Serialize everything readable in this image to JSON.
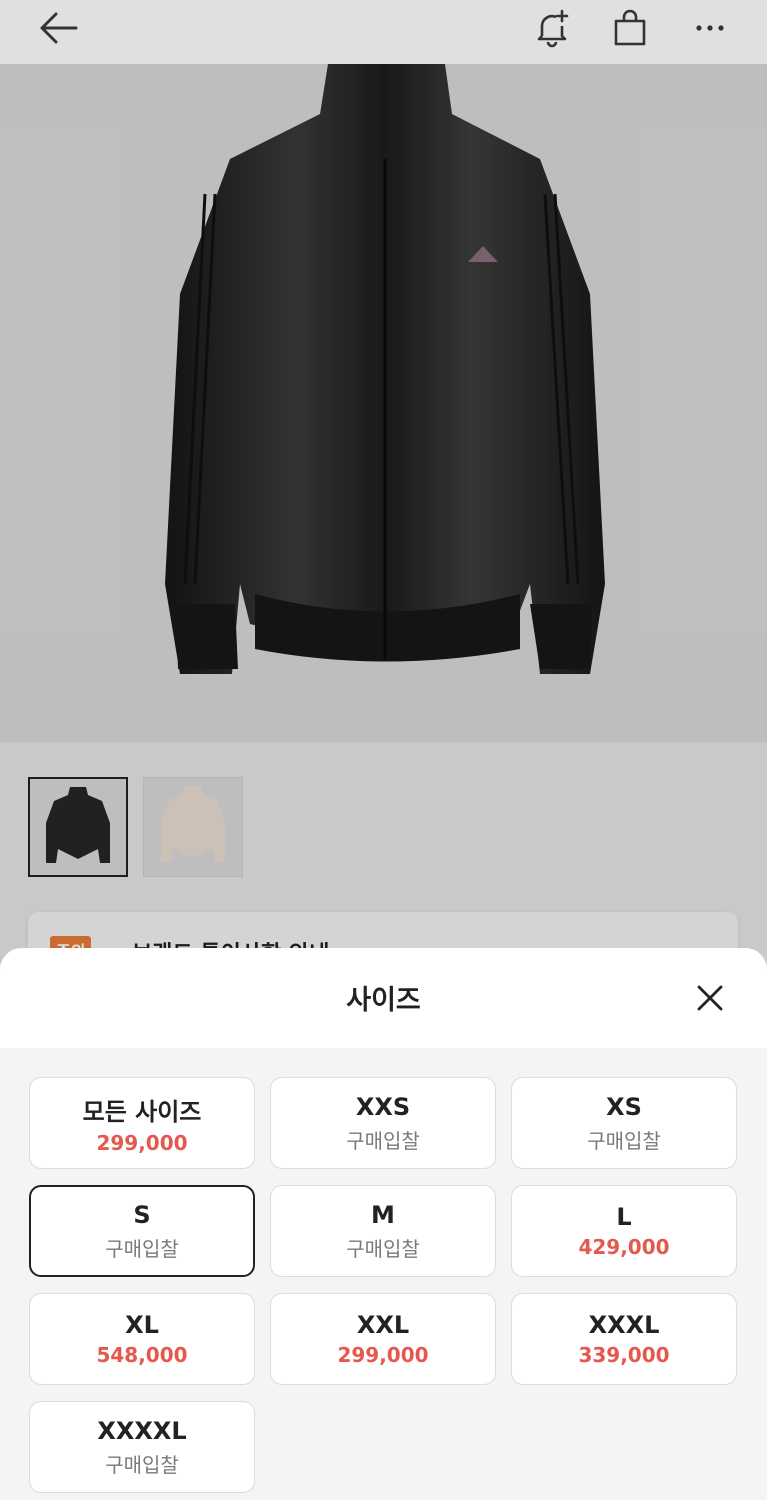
{
  "header": {
    "back_icon": "arrow-left-icon",
    "bell_icon": "bell-plus-icon",
    "bag_icon": "shopping-bag-icon",
    "more_icon": "more-horizontal-icon"
  },
  "notice": {
    "tag": "주의",
    "text": "브랜드 특이사항 안내"
  },
  "sheet": {
    "title": "사이즈",
    "close_icon": "close-icon"
  },
  "sizes": [
    {
      "label": "모든 사이즈",
      "sub": "299,000",
      "is_price": true,
      "selected": false
    },
    {
      "label": "XXS",
      "sub": "구매입찰",
      "is_price": false,
      "selected": false
    },
    {
      "label": "XS",
      "sub": "구매입찰",
      "is_price": false,
      "selected": false
    },
    {
      "label": "S",
      "sub": "구매입찰",
      "is_price": false,
      "selected": true
    },
    {
      "label": "M",
      "sub": "구매입찰",
      "is_price": false,
      "selected": false
    },
    {
      "label": "L",
      "sub": "429,000",
      "is_price": true,
      "selected": false
    },
    {
      "label": "XL",
      "sub": "548,000",
      "is_price": true,
      "selected": false
    },
    {
      "label": "XXL",
      "sub": "299,000",
      "is_price": true,
      "selected": false
    },
    {
      "label": "XXXL",
      "sub": "339,000",
      "is_price": true,
      "selected": false
    },
    {
      "label": "XXXXL",
      "sub": "구매입찰",
      "is_price": false,
      "selected": false
    }
  ],
  "colors": {
    "price": "#e5584d",
    "notice_tag": "#e87a3a",
    "selected_border": "#222222"
  }
}
